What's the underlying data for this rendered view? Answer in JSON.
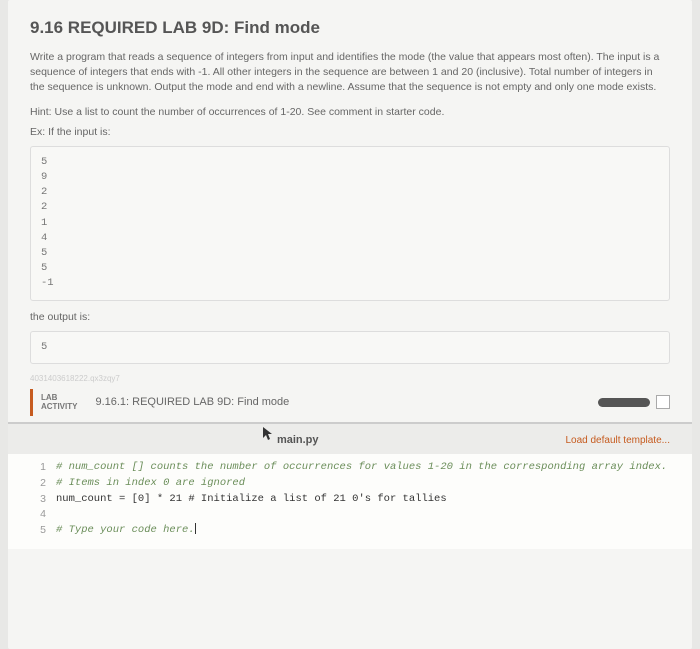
{
  "heading": "9.16 REQUIRED LAB 9D: Find mode",
  "description": "Write a program that reads a sequence of integers from input and identifies the mode (the value that appears most often). The input is a sequence of integers that ends with -1. All other integers in the sequence are between 1 and 20 (inclusive). Total number of integers in the sequence is unknown. Output the mode and end with a newline. Assume that the sequence is not empty and only one mode exists.",
  "hint": "Hint: Use a list to count the number of occurrences of 1-20. See comment in starter code.",
  "input_label": "Ex: If the input is:",
  "input_box": "5\n9\n2\n2\n1\n4\n5\n5\n-1",
  "output_label": "the output is:",
  "output_box": "5",
  "faint_id": "4031403618222.qx3zqy7",
  "lab": {
    "tab_line1": "LAB",
    "tab_line2": "ACTIVITY",
    "title": "9.16.1: REQUIRED LAB 9D: Find mode"
  },
  "code": {
    "filename": "main.py",
    "load_template": "Load default template...",
    "lines": [
      {
        "n": "1",
        "text": "# num_count [] counts the number of occurrences for values 1-20 in the corresponding array index."
      },
      {
        "n": "2",
        "text": "# Items in index 0 are ignored"
      },
      {
        "n": "3",
        "text": "num_count = [0] * 21  # Initialize a list of 21 0's for tallies"
      },
      {
        "n": "4",
        "text": ""
      },
      {
        "n": "5",
        "text": "# Type your code here."
      }
    ]
  }
}
